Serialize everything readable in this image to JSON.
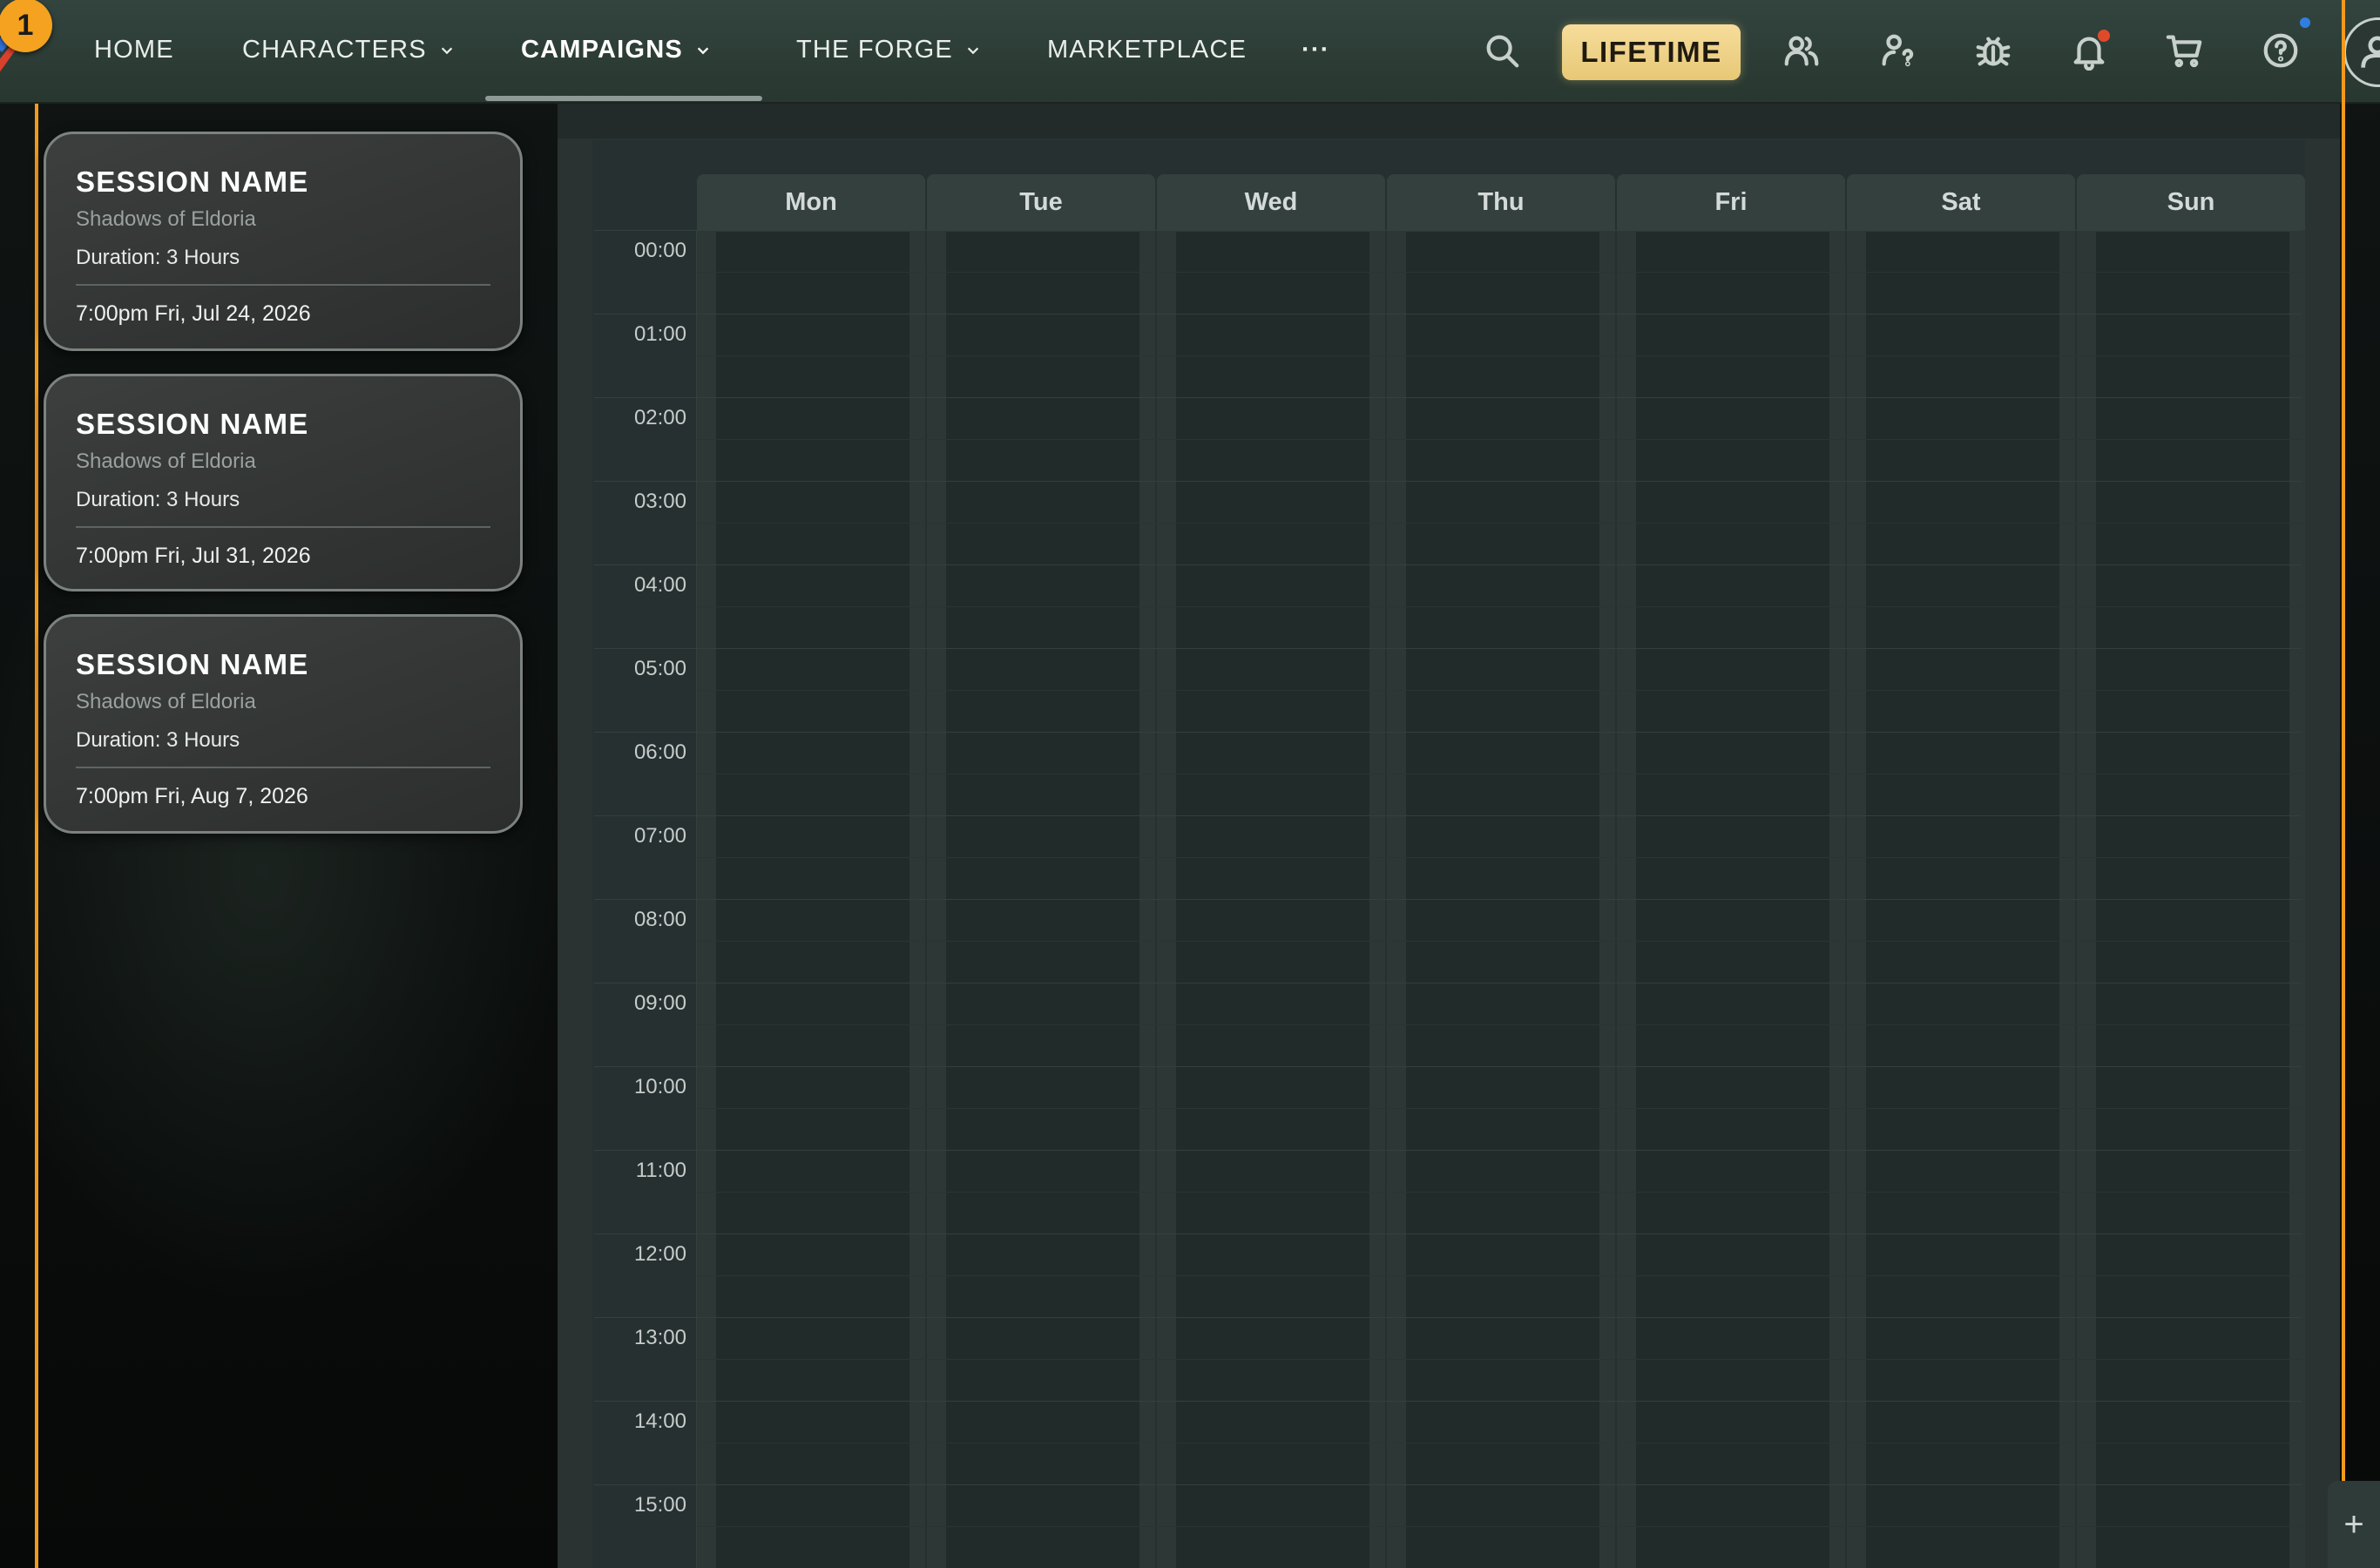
{
  "logo": {
    "badge": "1"
  },
  "nav": {
    "home": "HOME",
    "characters": "CHARACTERS",
    "campaigns": "CAMPAIGNS",
    "forge": "THE FORGE",
    "marketplace": "MARKETPLACE",
    "more": "···"
  },
  "lifetime": "LIFETIME",
  "icons": [
    "search-icon",
    "friends-icon",
    "user-help-icon",
    "bug-icon",
    "bell-icon",
    "cart-icon",
    "help-icon",
    "profile-icon"
  ],
  "colors": {
    "accent": "#f29a1c",
    "lifetime": "#f3d68a",
    "notify_red": "#e04a2a",
    "notify_blue": "#2f7fe0"
  },
  "sessions": [
    {
      "name": "SESSION NAME",
      "campaign": "Shadows of Eldoria",
      "duration": "Duration: 3 Hours",
      "datetime": "7:00pm Fri, Jul 24, 2026"
    },
    {
      "name": "SESSION NAME",
      "campaign": "Shadows of Eldoria",
      "duration": "Duration: 3 Hours",
      "datetime": "7:00pm Fri, Jul 31, 2026"
    },
    {
      "name": "SESSION NAME",
      "campaign": "Shadows of Eldoria",
      "duration": "Duration: 3 Hours",
      "datetime": "7:00pm Fri, Aug 7, 2026"
    }
  ],
  "calendar": {
    "days": [
      "Mon",
      "Tue",
      "Wed",
      "Thu",
      "Fri",
      "Sat",
      "Sun"
    ],
    "hours": [
      "00:00",
      "01:00",
      "02:00",
      "03:00",
      "04:00",
      "05:00",
      "06:00",
      "07:00",
      "08:00",
      "09:00",
      "10:00",
      "11:00",
      "12:00",
      "13:00",
      "14:00",
      "15:00"
    ],
    "add_button": "+"
  }
}
